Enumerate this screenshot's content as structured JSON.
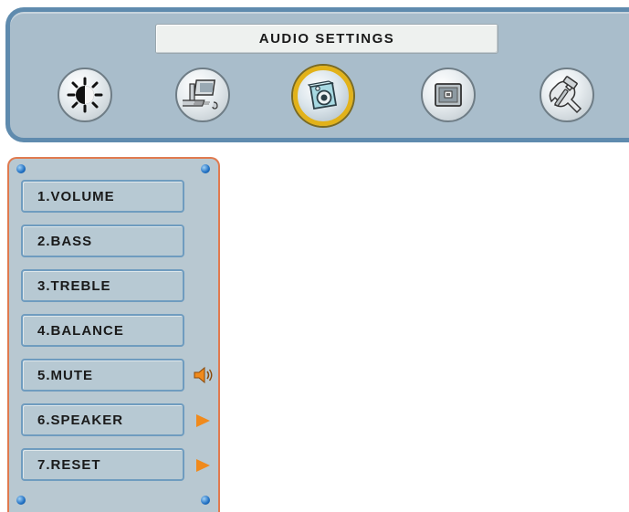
{
  "header": {
    "title": "AUDIO SETTINGS",
    "icons": [
      {
        "name": "brightness-icon"
      },
      {
        "name": "computer-icon"
      },
      {
        "name": "speaker-icon",
        "active": true
      },
      {
        "name": "picture-icon"
      },
      {
        "name": "tools-icon"
      }
    ]
  },
  "menu": {
    "items": [
      {
        "label": "1.VOLUME",
        "side_icon": null
      },
      {
        "label": "2.BASS",
        "side_icon": null
      },
      {
        "label": "3.TREBLE",
        "side_icon": null
      },
      {
        "label": "4.BALANCE",
        "side_icon": null
      },
      {
        "label": "5.MUTE",
        "side_icon": "volume-speaker-icon"
      },
      {
        "label": "6.SPEAKER",
        "side_icon": "arrow-right-icon"
      },
      {
        "label": "7.RESET",
        "side_icon": "arrow-right-icon"
      }
    ]
  },
  "colors": {
    "header_bg": "#a9bdcb",
    "header_border": "#5f8bae",
    "panel_bg": "#b8c8d1",
    "panel_border": "#e07a4f",
    "item_border": "#6f9cbf",
    "active_ring": "#e2b21a",
    "arrow": "#f08a1c"
  }
}
